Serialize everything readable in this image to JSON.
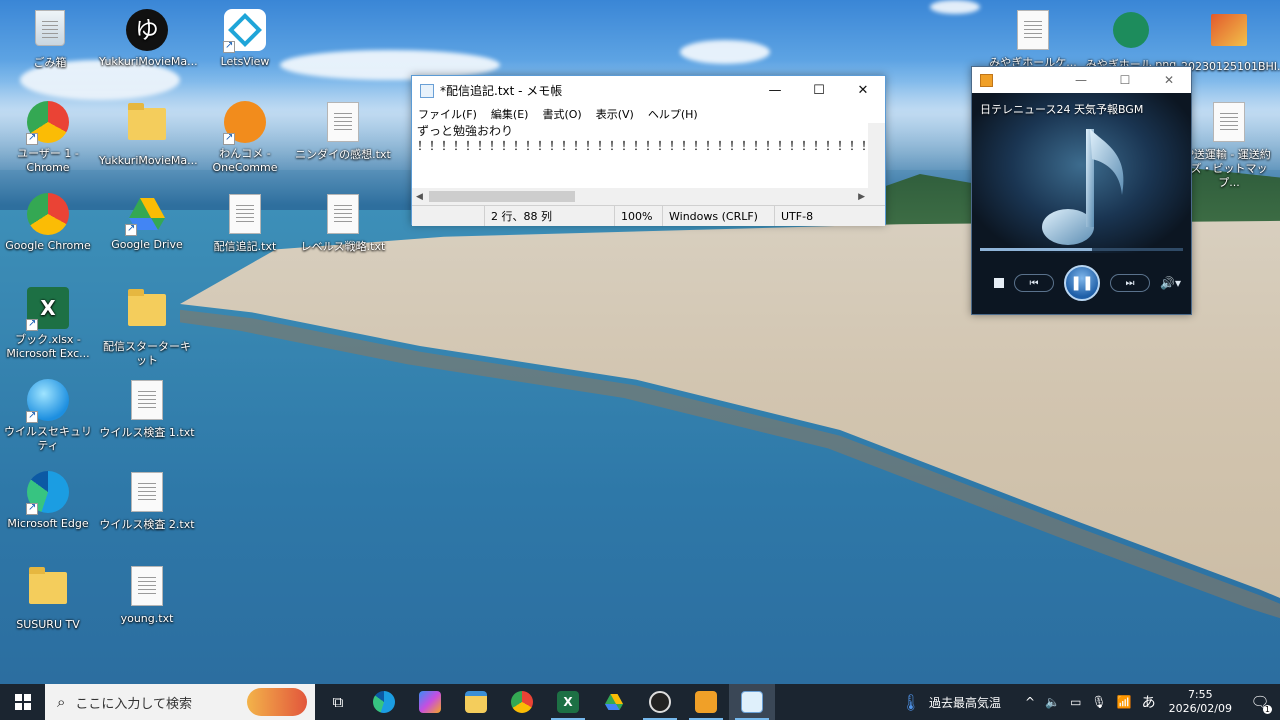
{
  "desktop": {
    "icons": [
      {
        "label": "ごみ箱",
        "icon": "recycle-bin-icon"
      },
      {
        "label": "YukkuriMovieMa...",
        "icon": "yukkuri-icon"
      },
      {
        "label": "LetsView",
        "icon": "letsview-icon"
      },
      {
        "label": "ユーザー 1 - Chrome",
        "icon": "chrome-user-icon"
      },
      {
        "label": "YukkuriMovieMa...",
        "icon": "folder-icon"
      },
      {
        "label": "わんコメ - OneComme",
        "icon": "onecomme-icon"
      },
      {
        "label": "ニンダイの感想.txt",
        "icon": "text-file-icon"
      },
      {
        "label": "Google Chrome",
        "icon": "chrome-icon"
      },
      {
        "label": "Google Drive",
        "icon": "google-drive-icon"
      },
      {
        "label": "配信追記.txt",
        "icon": "text-file-icon"
      },
      {
        "label": "レベルス戦略.txt",
        "icon": "text-file-icon"
      },
      {
        "label": "ブック.xlsx - Microsoft Exc...",
        "icon": "excel-icon"
      },
      {
        "label": "配信スターターキット",
        "icon": "folder-icon"
      },
      {
        "label": "ウイルスセキュリティ",
        "icon": "security-icon"
      },
      {
        "label": "ウイルス検査 1.txt",
        "icon": "text-file-icon"
      },
      {
        "label": "Microsoft Edge",
        "icon": "edge-icon"
      },
      {
        "label": "ウイルス検査 2.txt",
        "icon": "text-file-icon"
      },
      {
        "label": "SUSURU TV",
        "icon": "music-folder-icon"
      },
      {
        "label": "young.txt",
        "icon": "text-file-icon"
      },
      {
        "label": "みやぎホールケ...",
        "icon": "text-file-icon"
      },
      {
        "label": "みやぎホール.png",
        "icon": "image-icon"
      },
      {
        "label": "20230125101BHI...",
        "icon": "image-icon"
      },
      {
        "label": "P送運輸 - 運送約ズ・ビットマップ...",
        "icon": "text-file-icon"
      }
    ]
  },
  "notepad": {
    "title": "*配信追記.txt - メモ帳",
    "menu": [
      "ファイル(F)",
      "編集(E)",
      "書式(O)",
      "表示(V)",
      "ヘルプ(H)"
    ],
    "text": "ずっと勉強おわり\n！！！！！！！！！！！！！！！！！！！！！！！！！！！！！！！！！！！！！！！",
    "status": {
      "position": "2 行、88 列",
      "zoom": "100%",
      "line_ending": "Windows (CRLF)",
      "encoding": "UTF-8"
    }
  },
  "player": {
    "track": "日テレニュース24 天気予報BGM",
    "progress": 0.55,
    "stop_label": "■",
    "prev_label": "⏮",
    "play_label": "❚❚",
    "next_label": "⏭",
    "volume_label": "🔊▾"
  },
  "taskbar": {
    "search_placeholder": "ここに入力して検索",
    "weather": "過去最高気温",
    "ime": "あ",
    "time": "7:55",
    "date": "2026/02/09",
    "notification_count": "1"
  }
}
